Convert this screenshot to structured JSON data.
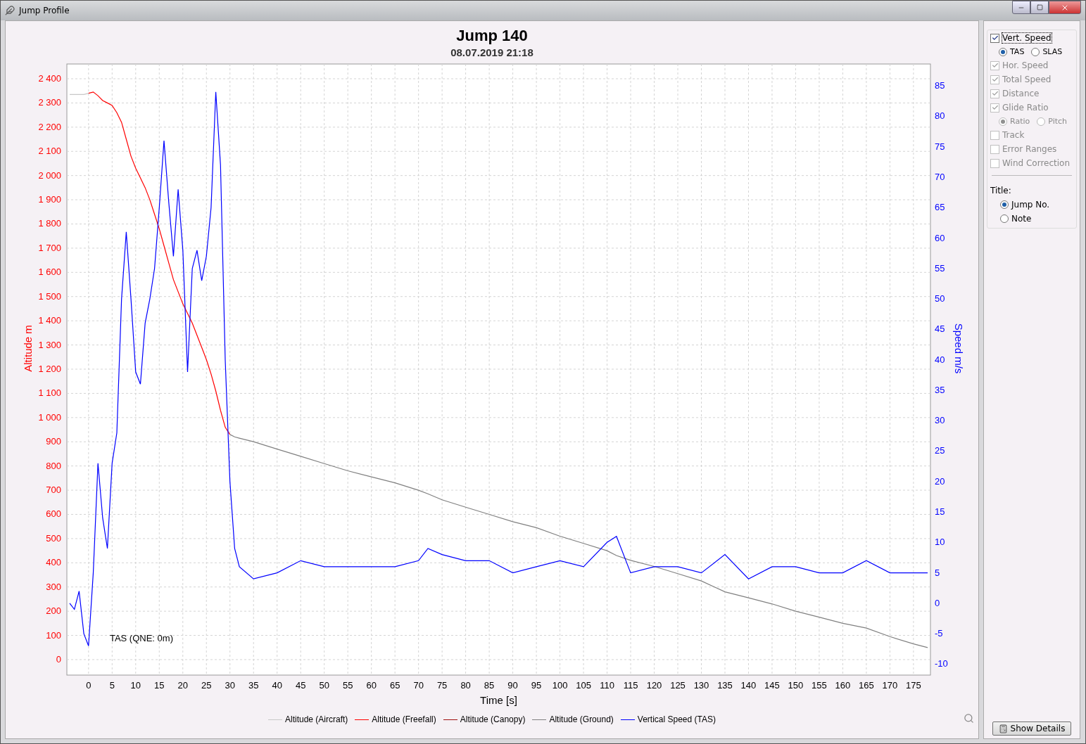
{
  "window": {
    "title": "Jump Profile"
  },
  "chart": {
    "title": "Jump 140",
    "subtitle": "08.07.2019 21:18",
    "chart_data": {
      "type": "line",
      "xlabel": "Time [s]",
      "ylabel": "Altitude m",
      "y2label": "Speed m/s",
      "grid": true,
      "xlim": [
        -4.6,
        178.6
      ],
      "ylim": [
        -64,
        2461
      ],
      "y2lim": [
        -11.8,
        88.6
      ],
      "xticks": [
        0,
        5,
        10,
        15,
        20,
        25,
        30,
        35,
        40,
        45,
        50,
        55,
        60,
        65,
        70,
        75,
        80,
        85,
        90,
        95,
        100,
        105,
        110,
        115,
        120,
        125,
        130,
        135,
        140,
        145,
        150,
        155,
        160,
        165,
        170,
        175
      ],
      "yticks": [
        {
          "value": 0,
          "label": "0"
        },
        {
          "value": 100,
          "label": "100"
        },
        {
          "value": 200,
          "label": "200"
        },
        {
          "value": 300,
          "label": "300"
        },
        {
          "value": 400,
          "label": "400"
        },
        {
          "value": 500,
          "label": "500"
        },
        {
          "value": 600,
          "label": "600"
        },
        {
          "value": 700,
          "label": "700"
        },
        {
          "value": 800,
          "label": "800"
        },
        {
          "value": 900,
          "label": "900"
        },
        {
          "value": 1000,
          "label": "1 000"
        },
        {
          "value": 1100,
          "label": "1 100"
        },
        {
          "value": 1200,
          "label": "1 200"
        },
        {
          "value": 1300,
          "label": "1 300"
        },
        {
          "value": 1400,
          "label": "1 400"
        },
        {
          "value": 1500,
          "label": "1 500"
        },
        {
          "value": 1600,
          "label": "1 600"
        },
        {
          "value": 1700,
          "label": "1 700"
        },
        {
          "value": 1800,
          "label": "1 800"
        },
        {
          "value": 1900,
          "label": "1 900"
        },
        {
          "value": 2000,
          "label": "2 000"
        },
        {
          "value": 2100,
          "label": "2 100"
        },
        {
          "value": 2200,
          "label": "2 200"
        },
        {
          "value": 2300,
          "label": "2 300"
        },
        {
          "value": 2400,
          "label": "2 400"
        }
      ],
      "y2ticks": [
        -10,
        -5,
        0,
        5,
        10,
        15,
        20,
        25,
        30,
        35,
        40,
        45,
        50,
        55,
        60,
        65,
        70,
        75,
        80,
        85
      ],
      "x": [
        -4,
        -3,
        -2,
        -1,
        0,
        1,
        2,
        3,
        4,
        5,
        6,
        7,
        8,
        9,
        10,
        11,
        12,
        13,
        14,
        15,
        16,
        17,
        18,
        19,
        20,
        21,
        22,
        23,
        24,
        25,
        26,
        27,
        28,
        29,
        30,
        31,
        32,
        35,
        40,
        45,
        50,
        55,
        60,
        65,
        70,
        72,
        75,
        80,
        85,
        90,
        95,
        100,
        105,
        110,
        112,
        115,
        120,
        125,
        130,
        135,
        140,
        145,
        150,
        155,
        160,
        165,
        170,
        175,
        178
      ],
      "series": [
        {
          "name": "Altitude (Aircraft)",
          "color": "#c8c8c8",
          "values": [
            2335,
            2335,
            2335,
            2335,
            2340,
            null,
            null,
            null,
            null,
            null,
            null,
            null,
            null,
            null,
            null,
            null,
            null,
            null,
            null,
            null,
            null,
            null,
            null,
            null,
            null,
            null,
            null,
            null,
            null,
            null,
            null,
            null,
            null,
            null,
            null,
            null,
            null,
            null,
            null,
            null,
            null,
            null,
            null,
            null,
            null,
            null,
            null,
            null,
            null,
            null,
            null,
            null,
            null,
            null,
            null,
            null,
            null,
            null,
            null,
            null,
            null,
            null,
            null,
            null,
            null,
            null,
            null,
            null,
            null
          ]
        },
        {
          "name": "Altitude (Freefall)",
          "color": "#ff0000",
          "values": [
            null,
            null,
            null,
            null,
            2340,
            2345,
            2330,
            2310,
            2300,
            2290,
            2260,
            2220,
            2150,
            2080,
            2030,
            1990,
            1950,
            1900,
            1840,
            1780,
            1710,
            1640,
            1570,
            1520,
            1470,
            1430,
            1390,
            1340,
            1290,
            1240,
            1180,
            1110,
            1030,
            960,
            930,
            null,
            null,
            null,
            null,
            null,
            null,
            null,
            null,
            null,
            null,
            null,
            null,
            null,
            null,
            null,
            null,
            null,
            null,
            null,
            null,
            null,
            null,
            null,
            null,
            null,
            null,
            null,
            null,
            null,
            null,
            null,
            null,
            null,
            null
          ]
        },
        {
          "name": "Altitude (Canopy)",
          "color": "#a01010",
          "values": [
            null,
            null,
            null,
            null,
            null,
            null,
            null,
            null,
            null,
            null,
            null,
            null,
            null,
            null,
            null,
            null,
            null,
            null,
            null,
            null,
            null,
            null,
            null,
            null,
            null,
            null,
            null,
            null,
            null,
            null,
            null,
            null,
            null,
            null,
            null,
            null,
            null,
            null,
            null,
            null,
            null,
            null,
            null,
            null,
            null,
            null,
            null,
            null,
            null,
            null,
            null,
            null,
            null,
            null,
            null,
            null,
            null,
            null,
            null,
            null,
            null,
            null,
            null,
            null,
            null,
            null,
            null,
            null,
            null
          ]
        },
        {
          "name": "Altitude (Ground)",
          "color": "#808080",
          "values": [
            null,
            null,
            null,
            null,
            null,
            null,
            null,
            null,
            null,
            null,
            null,
            null,
            null,
            null,
            null,
            null,
            null,
            null,
            null,
            null,
            null,
            null,
            null,
            null,
            null,
            null,
            null,
            null,
            null,
            null,
            null,
            null,
            null,
            null,
            930,
            920,
            915,
            900,
            870,
            840,
            810,
            780,
            755,
            730,
            700,
            685,
            660,
            630,
            600,
            570,
            545,
            510,
            480,
            450,
            430,
            410,
            385,
            355,
            325,
            280,
            255,
            230,
            200,
            175,
            150,
            130,
            95,
            65,
            50
          ]
        },
        {
          "name": "Vertical Speed (TAS)",
          "color": "#0000ff",
          "axis": "y2",
          "values": [
            0,
            -1,
            2,
            -5,
            -7,
            5,
            23,
            14,
            9,
            23,
            28,
            50,
            61,
            50,
            38,
            36,
            46,
            50,
            55,
            65,
            76,
            66,
            57,
            68,
            58,
            38,
            55,
            58,
            53,
            57,
            65,
            84,
            72,
            40,
            20,
            9,
            6,
            4,
            5,
            7,
            6,
            6,
            6,
            6,
            7,
            9,
            8,
            7,
            7,
            5,
            6,
            7,
            6,
            10,
            11,
            5,
            6,
            6,
            5,
            8,
            4,
            6,
            6,
            5,
            5,
            7,
            5,
            5,
            5
          ]
        }
      ],
      "annotations": [
        "TAS (QNE: 0m)"
      ]
    }
  },
  "options": [
    {
      "kind": "checkbox",
      "label": "Vert. Speed",
      "checked": true,
      "disabled": false,
      "focused": true
    },
    {
      "kind": "radios",
      "options": [
        {
          "label": "TAS",
          "selected": true,
          "disabled": false
        },
        {
          "label": "SLAS",
          "selected": false,
          "disabled": false
        }
      ]
    },
    {
      "kind": "checkbox",
      "label": "Hor. Speed",
      "checked": true,
      "disabled": true,
      "focused": false
    },
    {
      "kind": "checkbox",
      "label": "Total Speed",
      "checked": true,
      "disabled": true,
      "focused": false
    },
    {
      "kind": "checkbox",
      "label": "Distance",
      "checked": true,
      "disabled": true,
      "focused": false
    },
    {
      "kind": "checkbox",
      "label": "Glide Ratio",
      "checked": true,
      "disabled": true,
      "focused": false
    },
    {
      "kind": "radios",
      "options": [
        {
          "label": "Ratio",
          "selected": true,
          "disabled": true
        },
        {
          "label": "Pitch",
          "selected": false,
          "disabled": true
        }
      ]
    },
    {
      "kind": "checkbox",
      "label": "Track",
      "checked": false,
      "disabled": true,
      "focused": false
    },
    {
      "kind": "checkbox",
      "label": "Error Ranges",
      "checked": false,
      "disabled": true,
      "focused": false
    },
    {
      "kind": "checkbox",
      "label": "Wind Correction",
      "checked": false,
      "disabled": true,
      "focused": false
    }
  ],
  "title_option": {
    "label": "Title:",
    "options": [
      {
        "label": "Jump No.",
        "selected": true
      },
      {
        "label": "Note",
        "selected": false
      }
    ]
  },
  "details_button": "Show Details"
}
